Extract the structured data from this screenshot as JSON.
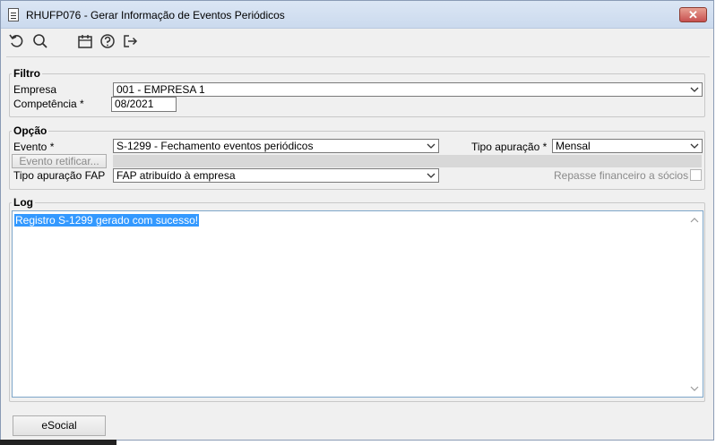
{
  "window": {
    "title": "RHUFP076 - Gerar Informação de Eventos Periódicos",
    "close_label": "✕"
  },
  "toolbar": {
    "icons": [
      "undo-icon",
      "search-icon",
      "calendar-icon",
      "help-icon",
      "exit-icon"
    ]
  },
  "filtro": {
    "legend": "Filtro",
    "empresa_label": "Empresa",
    "empresa_value": "001 - EMPRESA 1",
    "competencia_label": "Competência *",
    "competencia_value": "08/2021"
  },
  "opcao": {
    "legend": "Opção",
    "evento_label": "Evento *",
    "evento_value": "S-1299 - Fechamento eventos periódicos",
    "tipo_apuracao_label": "Tipo apuração *",
    "tipo_apuracao_value": "Mensal",
    "evento_retificar_label": "Evento retificar...",
    "tipo_apuracao_fap_label": "Tipo apuração FAP",
    "tipo_apuracao_fap_value": "FAP atribuído à empresa",
    "repasse_label": "Repasse financeiro a sócios"
  },
  "log": {
    "legend": "Log",
    "text": "Registro S-1299 gerado com sucesso!"
  },
  "footer": {
    "esocial_label": "eSocial"
  }
}
